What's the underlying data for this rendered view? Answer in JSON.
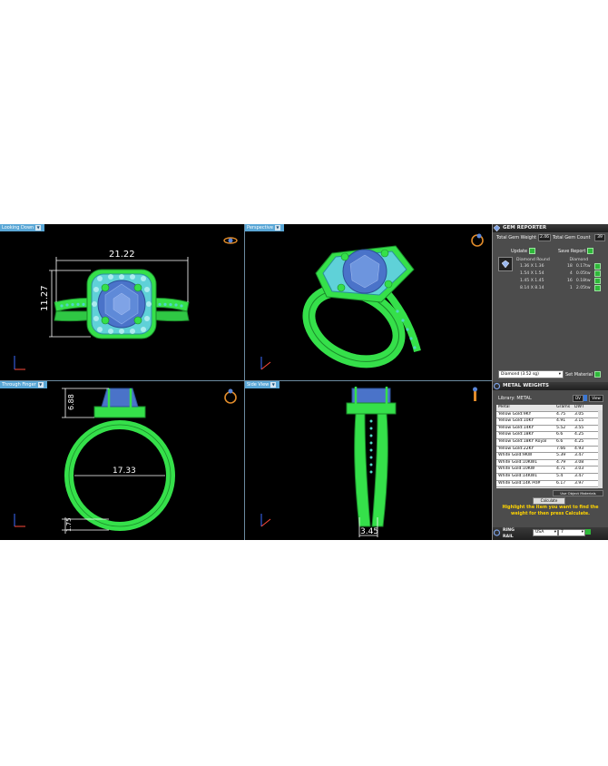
{
  "viewports": {
    "top_left": {
      "label": "Looking Down",
      "dims": [
        "21.22",
        "11.27"
      ]
    },
    "top_right": {
      "label": "Perspective"
    },
    "bottom_left": {
      "label": "Through Finger",
      "dims": [
        "6.88",
        "17.33",
        "1.75"
      ]
    },
    "bottom_right": {
      "label": "Side View",
      "dims": [
        "3.45"
      ]
    }
  },
  "gem_reporter": {
    "title": "GEM REPORTER",
    "total_weight_label": "Total Gem Weight",
    "total_weight_value": "2.46",
    "total_count_label": "Total Gem Count",
    "total_count_value": "39",
    "update_label": "Update",
    "save_report_label": "Save Report",
    "col_shape": "Diamond Round",
    "col_type": "Diamond",
    "rows": [
      {
        "size": "1.36 X 1.36",
        "count": "18",
        "weight": "0.17tw"
      },
      {
        "size": "1.54 X 1.54",
        "count": "4",
        "weight": "0.05tw"
      },
      {
        "size": "1.45 X 1.45",
        "count": "16",
        "weight": "0.18tw"
      },
      {
        "size": "8.14 X 8.14",
        "count": "1",
        "weight": "2.05tw"
      }
    ],
    "material_select": "Diamond  (3.52 sg)",
    "set_material_label": "Set Material"
  },
  "metal_weights": {
    "title": "METAL WEIGHTS",
    "library_label": "Library: METAL",
    "btn_a": "DV",
    "btn_b": "View",
    "col_metal": "Metal",
    "col_grams": "Grams",
    "col_dwt": "DWT",
    "rows": [
      {
        "metal": "Yellow Gold:9KY",
        "grams": "4.75",
        "dwt": "3.05"
      },
      {
        "metal": "Yellow Gold:10KY",
        "grams": "4.91",
        "dwt": "3.15"
      },
      {
        "metal": "Yellow Gold:14KY",
        "grams": "5.52",
        "dwt": "3.55"
      },
      {
        "metal": "Yellow Gold:18KY",
        "grams": "6.6",
        "dwt": "4.25"
      },
      {
        "metal": "Yellow Gold:18KY Royal",
        "grams": "6.6",
        "dwt": "4.25"
      },
      {
        "metal": "Yellow Gold:22KY",
        "grams": "7.66",
        "dwt": "4.93"
      },
      {
        "metal": "White Gold:9KW",
        "grams": "5.39",
        "dwt": "3.47"
      },
      {
        "metal": "White Gold:10KW1",
        "grams": "4.79",
        "dwt": "3.08"
      },
      {
        "metal": "White Gold:10KW",
        "grams": "4.71",
        "dwt": "3.03"
      },
      {
        "metal": "White Gold:14KW1",
        "grams": "5.4",
        "dwt": "3.47"
      },
      {
        "metal": "White Gold:14K Pd#",
        "grams": "6.17",
        "dwt": "3.97"
      }
    ],
    "use_object_materials": "Use Object Materials",
    "calculate_label": "Calculate",
    "hint": "Highlight the item you want to find the weight for then press Calculate.",
    "ring_rail_label": "RING RAIL",
    "country": "USA",
    "size": "7"
  },
  "colors": {
    "metal": "#35e04a",
    "gem": "#4a73c9",
    "accent_gem": "#4fd6c6",
    "label": "#5aa7d6"
  }
}
